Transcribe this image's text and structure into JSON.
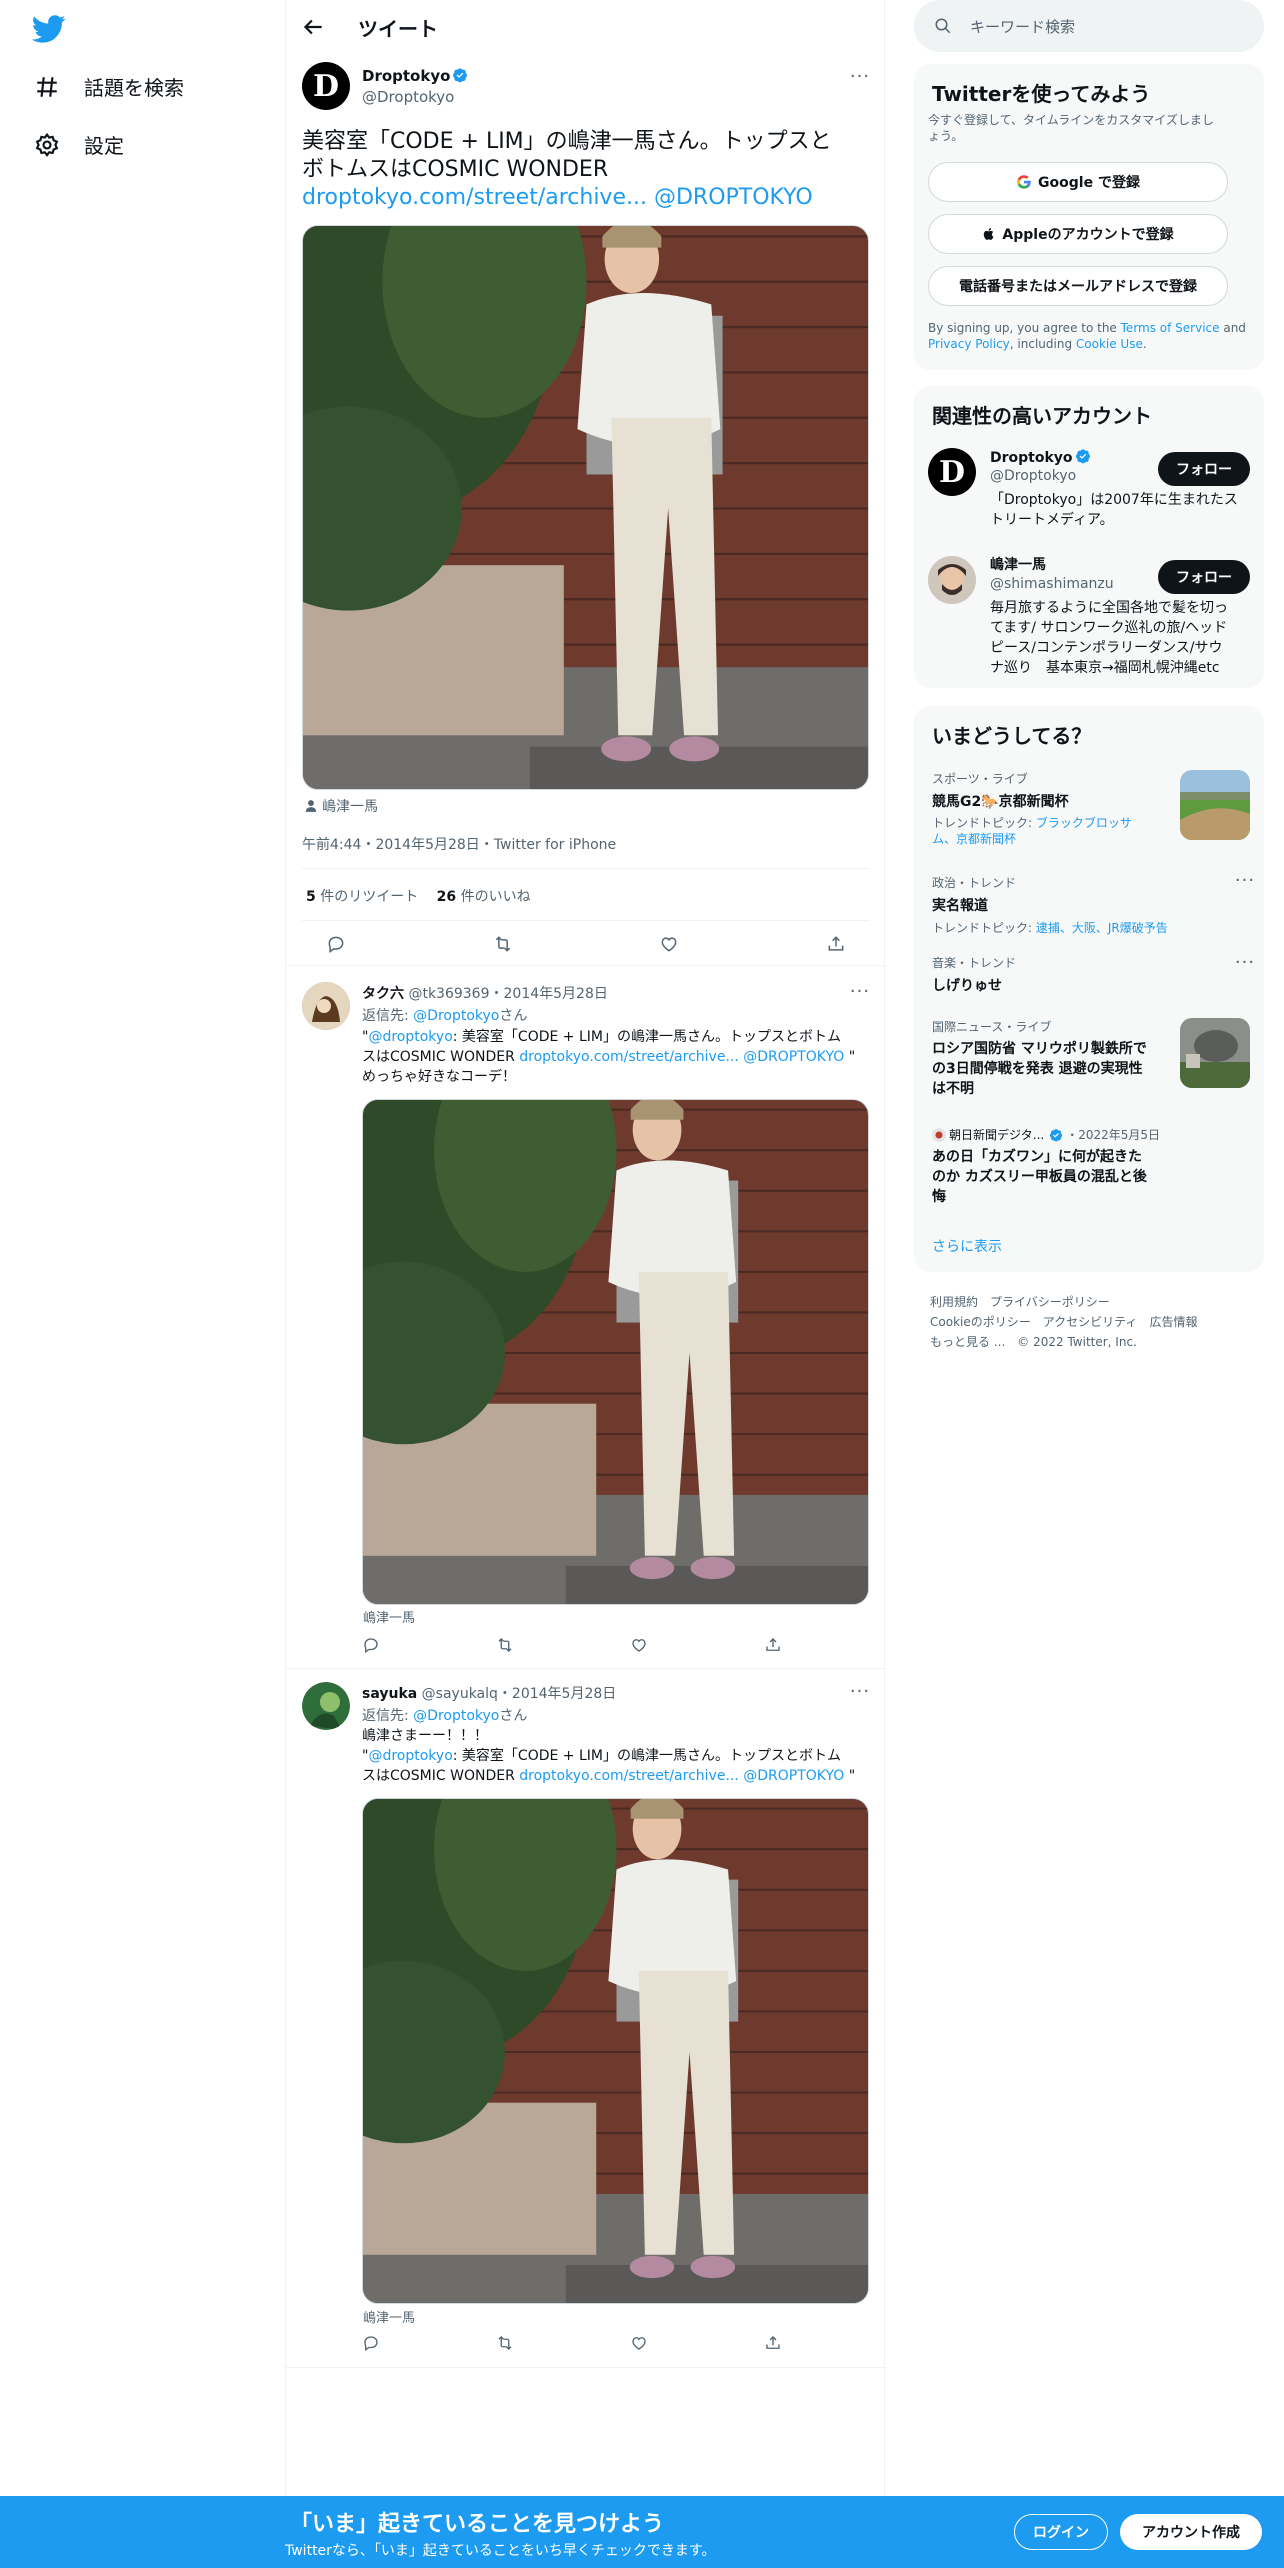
{
  "nav": {
    "explore_label": "話題を検索",
    "settings_label": "設定"
  },
  "header": {
    "title": "ツイート"
  },
  "main_tweet": {
    "author_name": "Droptokyo",
    "author_handle": "@Droptokyo",
    "text_line1": "美容室「CODE + LIM」の嶋津一馬さん。トップスと",
    "text_line2": "ボトムスはCOSMIC WONDER",
    "link": "droptokyo.com/street/archive...",
    "mention": "@DROPTOKYO",
    "photo_tag": "嶋津一馬",
    "timestamp": "午前4:44・2014年5月28日・Twitter for iPhone",
    "retweet_count": "5",
    "retweet_label": "件のリツイート",
    "like_count": "26",
    "like_label": "件のいいね"
  },
  "replies": [
    {
      "name": "タク六",
      "handle": "@tk369369",
      "date": "・2014年5月28日",
      "reply_prefix": "返信先: ",
      "reply_to": "@Droptokyo",
      "reply_suffix": "さん",
      "quote_open": "\"",
      "mention": "@droptokyo",
      "body1": ": 美容室「CODE + LIM」の嶋津一馬さん。トップスとボトム",
      "body2_prefix": "スはCOSMIC WONDER ",
      "link": "droptokyo.com/street/archive...",
      "mention2": "@DROPTOKYO",
      "quote_close": " \"",
      "extra": "めっちゃ好きなコーデ！",
      "photo_tag": "嶋津一馬"
    },
    {
      "name": "sayuka",
      "handle": "@sayukalq",
      "date": "・2014年5月28日",
      "reply_prefix": "返信先: ",
      "reply_to": "@Droptokyo",
      "reply_suffix": "さん",
      "extra": "嶋津さまーー！！！",
      "quote_open": "\"",
      "mention": "@droptokyo",
      "body1": ": 美容室「CODE + LIM」の嶋津一馬さん。トップスとボトム",
      "body2_prefix": "スはCOSMIC WONDER ",
      "link": "droptokyo.com/street/archive...",
      "mention2": "@DROPTOKYO",
      "quote_close": " \"",
      "photo_tag": "嶋津一馬"
    }
  ],
  "search": {
    "placeholder": "キーワード検索"
  },
  "signup": {
    "title": "Twitterを使ってみよう",
    "subtitle1": "今すぐ登録して、タイムラインをカスタマイズしまし",
    "subtitle2": "ょう。",
    "google": "Google で登録",
    "apple": "Appleのアカウントで登録",
    "phone": "電話番号またはメールアドレスで登録",
    "legal1_a": "By signing up, you agree to the ",
    "terms": "Terms of Service",
    "legal1_b": " and",
    "privacy": "Privacy Policy",
    "legal2": ", including ",
    "cookie": "Cookie Use",
    "legal_end": "."
  },
  "related": {
    "title": "関連性の高いアカウント",
    "follow": "フォロー",
    "accounts": [
      {
        "name": "Droptokyo",
        "handle": "@Droptokyo",
        "bio1": "「Droptokyo」は2007年に生まれたス",
        "bio2": "トリートメディア。"
      },
      {
        "name": "嶋津一馬",
        "handle": "@shimashimanzu",
        "bio1": "毎月旅するように全国各地で髪を切っ",
        "bio2": "てます/ サロンワーク巡礼の旅/ヘッド",
        "bio3": "ピース/コンテンポラリーダンス/サウ",
        "bio4": "ナ巡り　基本東京→福岡札幌沖縄etc"
      }
    ]
  },
  "trends": {
    "title": "いまどうしてる？",
    "items": [
      {
        "meta": "スポーツ・ライブ",
        "title": "競馬G2🐎京都新聞杯",
        "sub_prefix": "トレンドトピック: ",
        "sub1": "ブラックブロッサ",
        "sub2": "ム、京都新聞杯"
      },
      {
        "meta": "政治・トレンド",
        "title": "実名報道",
        "sub_prefix": "トレンドトピック: ",
        "sub1": "逮捕、大阪、JR爆破予告"
      },
      {
        "meta": "音楽・トレンド",
        "title": "しげりゅせ"
      },
      {
        "meta": "国際ニュース・ライブ",
        "title1": "ロシア国防省 マリウポリ製鉄所で",
        "title2": "の3日間停戦を発表 退避の実現性",
        "title3": "は不明"
      },
      {
        "meta_name": "朝日新聞デジタ...",
        "meta_date": "・2022年5月5日",
        "title1": "あの日「カズワン」に何が起きた",
        "title2": "のか カズスリー甲板員の混乱と後",
        "title3": "悔"
      }
    ],
    "show_more": "さらに表示"
  },
  "footer": {
    "l1": "利用規約",
    "l2": "プライバシーポリシー",
    "l3": "Cookieのポリシー",
    "l4": "アクセシビリティ",
    "l5": "広告情報",
    "l6": "もっと見る ...",
    "l7": "© 2022 Twitter, Inc."
  },
  "bottom": {
    "headline": "「いま」起きていることを見つけよう",
    "sub": "Twitterなら、「いま」起きていることをいち早くチェックできます。",
    "login": "ログイン",
    "signup": "アカウント作成"
  },
  "colors": {
    "accent": "#1d9bf0",
    "text": "#0f1419",
    "secondary": "#536471"
  }
}
